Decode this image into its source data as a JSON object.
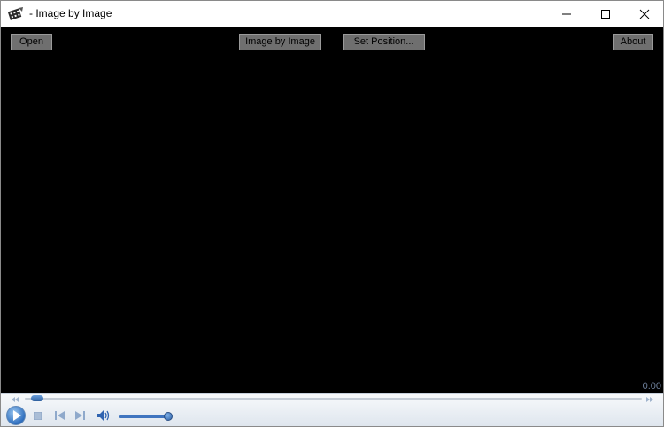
{
  "window": {
    "title": "- Image by Image",
    "icon": "film-strip-icon"
  },
  "toolbar": {
    "open_label": "Open",
    "image_by_image_label": "Image by Image",
    "set_position_label": "Set Position...",
    "about_label": "About"
  },
  "player": {
    "time": "0.00",
    "seek_progress": 0.01,
    "volume_level": 0.9
  },
  "colors": {
    "video_background": "#000000",
    "button_face": "#6f6f6f",
    "accent": "#2f6fbf"
  }
}
